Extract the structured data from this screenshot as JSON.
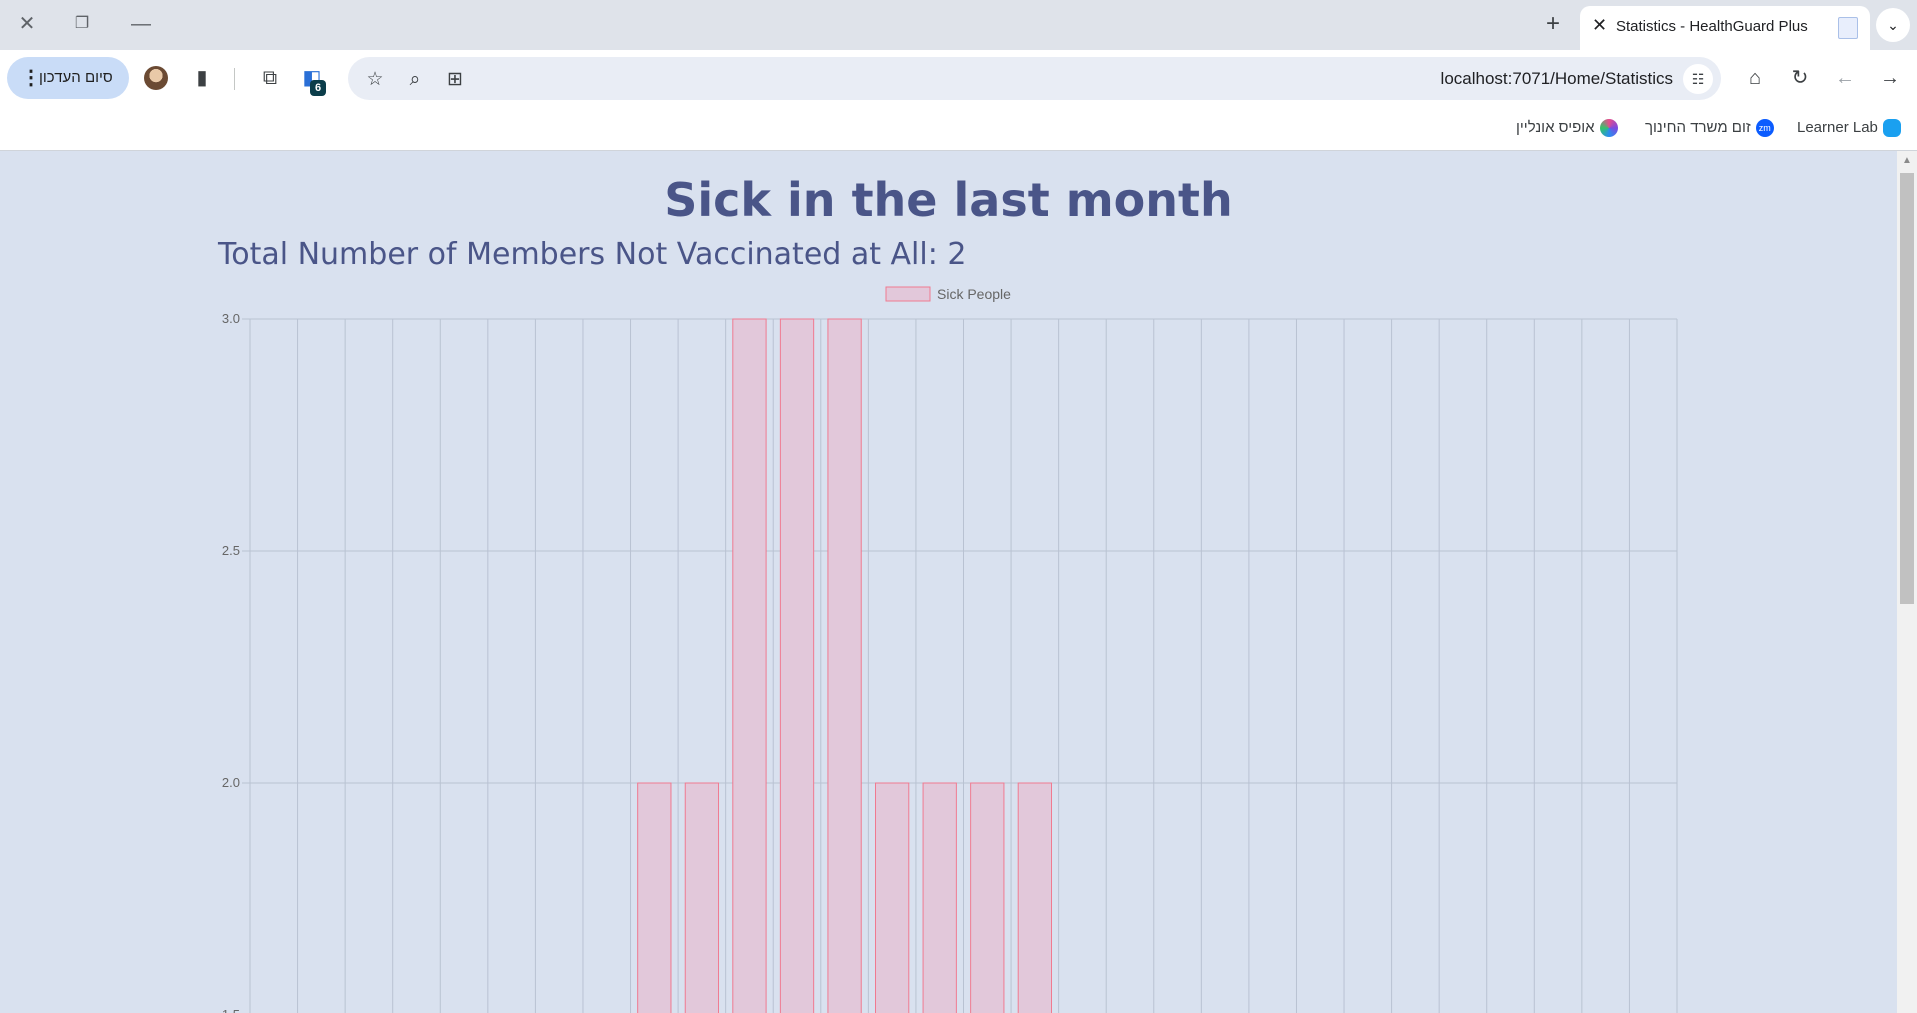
{
  "browser": {
    "tab_title": "Statistics - HealthGuard Plus",
    "url": "localhost:7071/Home/Statistics",
    "update_button_label": "סיום העדכון",
    "extension_badge": "6",
    "bookmarks": [
      {
        "label": "Learner Lab",
        "icon": "cloud-icon"
      },
      {
        "label": "זום משרד החינוך",
        "icon": "zoom-icon"
      },
      {
        "label": "אופיס אונליין",
        "icon": "office-icon"
      }
    ]
  },
  "page": {
    "title": "Sick in the last month",
    "subtitle": "Total Number of Members Not Vaccinated at All: 2"
  },
  "chart_data": {
    "type": "bar",
    "legend": "Sick People",
    "legend_position": "top-center",
    "bar_fill": "#e2c8da",
    "bar_stroke": "#f07a90",
    "grid": true,
    "categories_count": 30,
    "values": [
      0,
      0,
      0,
      0,
      0,
      0,
      0,
      0,
      2,
      2,
      3,
      3,
      3,
      2,
      2,
      2,
      2,
      0,
      0,
      0,
      0,
      0,
      0,
      0,
      0,
      0,
      0,
      0,
      0,
      0
    ],
    "y_ticks": [
      "3.0",
      "2.5",
      "2.0",
      "1.5"
    ],
    "ylim_visible": [
      1.5,
      3.0
    ]
  }
}
